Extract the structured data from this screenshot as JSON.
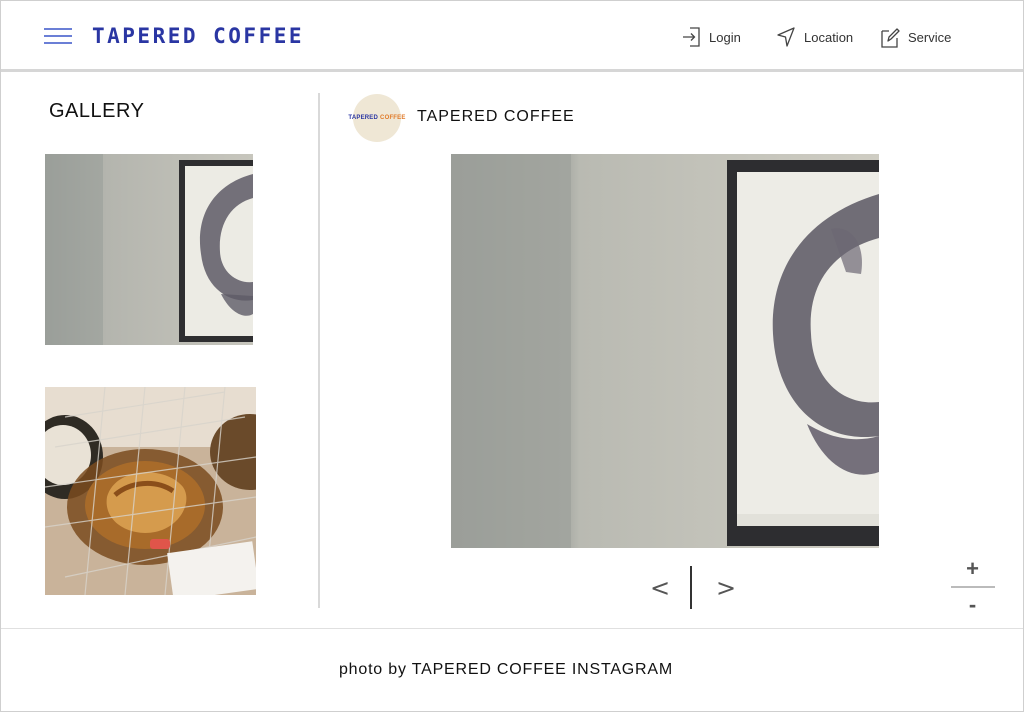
{
  "header": {
    "brand": "TAPERED COFFEE",
    "nav": [
      {
        "label": "Login",
        "icon": "login-icon"
      },
      {
        "label": "Location",
        "icon": "location-icon"
      },
      {
        "label": "Service",
        "icon": "edit-icon"
      }
    ]
  },
  "sidebar": {
    "title": "GALLERY",
    "thumbnails": [
      {
        "icon": "artwork-wall-photo"
      },
      {
        "icon": "pastry-photo"
      }
    ]
  },
  "profile": {
    "name": "TAPERED COFFEE",
    "avatar_text_1": "TAPERED",
    "avatar_text_2": "COFFEE"
  },
  "viewer": {
    "prev_label": "<",
    "next_label": ">",
    "zoom_in_label": "+",
    "zoom_out_label": "-"
  },
  "footer": {
    "credit": "photo by TAPERED COFFEE INSTAGRAM"
  },
  "colors": {
    "brand": "#2a36a3",
    "menu_icon": "#6b7fd6",
    "avatar_bg": "#efe7d5",
    "avatar_accent": "#e07a28"
  }
}
